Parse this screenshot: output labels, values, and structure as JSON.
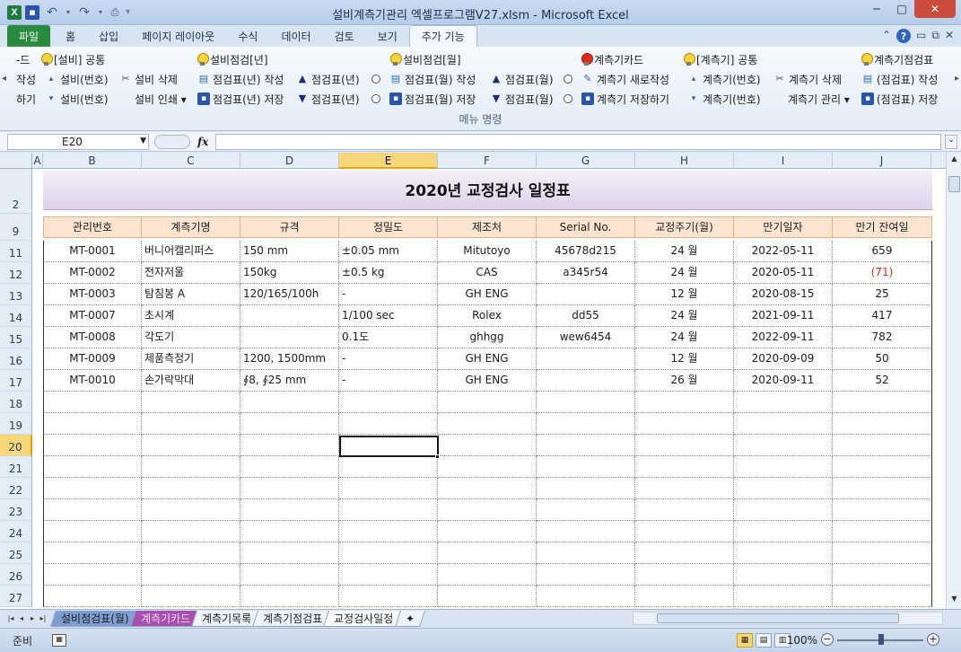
{
  "window": {
    "title": "설비계측기관리 엑셀프로그램V27.xlsm  -  Microsoft Excel",
    "minimize": "─",
    "maximize": "□",
    "close": "✕"
  },
  "qat": {
    "app_icon": "X",
    "undo": "↶",
    "redo": "↷",
    "more": "▾"
  },
  "ribbon_tabs": [
    "파일",
    "홈",
    "삽입",
    "페이지 레이아웃",
    "수식",
    "데이터",
    "검토",
    "보기",
    "추가 기능"
  ],
  "ribbon_tab_active_index": 8,
  "ribbon": {
    "group_label": "메뉴 명령",
    "row1": [
      {
        "icon": "none",
        "label": "-드"
      },
      {
        "icon": "bulb-icon",
        "label": "[설비] 공통"
      },
      {
        "icon": "bulb-icon",
        "label": "설비점검[년]"
      },
      {
        "icon": "bulb-icon",
        "label": "설비점검[월]"
      },
      {
        "icon": "bulb-red-icon",
        "label": "계측기카드"
      },
      {
        "icon": "bulb-icon",
        "label": "[계측기] 공통"
      },
      {
        "icon": "bulb-icon",
        "label": "계측기점검표"
      }
    ],
    "row2": [
      {
        "icon": "none",
        "label": "작성"
      },
      {
        "icon": "sort-up-icon",
        "label": "설비(번호)"
      },
      {
        "icon": "scissors-icon",
        "label": "설비 삭제"
      },
      {
        "icon": "doc-icon",
        "label": "점검표(년) 작성"
      },
      {
        "icon": "triangle-up-icon",
        "label": "점검표(년)"
      },
      {
        "icon": "doc-icon",
        "label": "점검표(월) 작성"
      },
      {
        "icon": "triangle-up-icon",
        "label": "점검표(월)"
      },
      {
        "icon": "new-icon",
        "label": "계측기 새로작성"
      },
      {
        "icon": "sort-up-icon",
        "label": "계측기(번호)"
      },
      {
        "icon": "scissors-icon",
        "label": "계측기 삭제"
      },
      {
        "icon": "doc-icon",
        "label": "(점검표) 작성"
      }
    ],
    "row3": [
      {
        "icon": "none",
        "label": "하기"
      },
      {
        "icon": "sort-down-icon",
        "label": "설비(번호)"
      },
      {
        "icon": "none",
        "label": "설비 인쇄 ▾"
      },
      {
        "icon": "save-icon",
        "label": "점검표(년) 저장"
      },
      {
        "icon": "triangle-down-icon",
        "label": "점검표(년)"
      },
      {
        "icon": "save-icon",
        "label": "점검표(월) 저장"
      },
      {
        "icon": "triangle-down-icon",
        "label": "점검표(월)"
      },
      {
        "icon": "save-icon",
        "label": "계측기 저장하기"
      },
      {
        "icon": "sort-down-icon",
        "label": "계측기(번호)"
      },
      {
        "icon": "none",
        "label": "계측기 관리 ▾"
      },
      {
        "icon": "save-icon",
        "label": "(점검표) 저장"
      }
    ]
  },
  "formula_bar": {
    "name_box": "E20",
    "fx_label": "fx",
    "formula": ""
  },
  "columns": [
    "A",
    "B",
    "C",
    "D",
    "E",
    "F",
    "G",
    "H",
    "I",
    "J"
  ],
  "selected_column": "E",
  "sheet": {
    "title": "2020년 교정검사 일정표",
    "headers": [
      "관리번호",
      "계측기명",
      "규격",
      "정밀도",
      "제조처",
      "Serial No.",
      "교정주기(월)",
      "만기일자",
      "만기 잔여일"
    ],
    "row_numbers_top": [
      "2",
      "9"
    ],
    "rows": [
      {
        "row": "11",
        "cells": [
          "MT-0001",
          "버니어캘리퍼스",
          "150 mm",
          "±0.05 mm",
          "Mitutoyo",
          "45678d215",
          "24 월",
          "2022-05-11",
          "659"
        ]
      },
      {
        "row": "12",
        "cells": [
          "MT-0002",
          "전자저울",
          "150kg",
          "±0.5 kg",
          "CAS",
          "a345r54",
          "24 월",
          "2020-05-11",
          "(71)"
        ]
      },
      {
        "row": "13",
        "cells": [
          "MT-0003",
          "탐침봉 A",
          "120/165/100h",
          "-",
          "GH ENG",
          "",
          "12 월",
          "2020-08-15",
          "25"
        ]
      },
      {
        "row": "14",
        "cells": [
          "MT-0007",
          "초시계",
          "",
          "1/100 sec",
          "Rolex",
          "dd55",
          "24 월",
          "2021-09-11",
          "417"
        ]
      },
      {
        "row": "15",
        "cells": [
          "MT-0008",
          "각도기",
          "",
          "0.1도",
          "ghhgg",
          "wew6454",
          "24 월",
          "2022-09-11",
          "782"
        ]
      },
      {
        "row": "16",
        "cells": [
          "MT-0009",
          "제품측정기",
          "1200, 1500mm",
          "-",
          "GH ENG",
          "",
          "12 월",
          "2020-09-09",
          "50"
        ]
      },
      {
        "row": "17",
        "cells": [
          "MT-0010",
          "손가락막대",
          "∮8, ∮25 mm",
          "-",
          "GH ENG",
          "",
          "26 월",
          "2020-09-11",
          "52"
        ]
      }
    ],
    "empty_rows": [
      "18",
      "19",
      "20",
      "21",
      "22",
      "23",
      "24",
      "25",
      "26",
      "27"
    ],
    "selected_row": "20",
    "negative_color": "#d0281b"
  },
  "sheet_tabs": [
    "설비점검표(월)",
    "계측기카드",
    "계측기목록",
    "계측기점검표",
    "교정검사일정"
  ],
  "active_sheet_tab_index": 4,
  "status": {
    "ready": "준비",
    "zoom": "100%",
    "zoom_value": 100
  }
}
